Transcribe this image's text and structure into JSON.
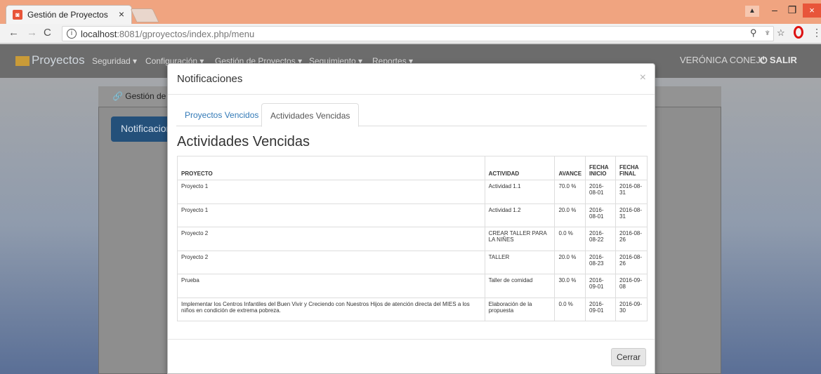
{
  "browser": {
    "tab_title": "Gestión de Proyectos",
    "tab_close": "×",
    "url_host": "localhost",
    "url_rest": ":8081/gproyectos/index.php/menu",
    "window_min": "–",
    "window_max": "❐",
    "window_close": "×"
  },
  "navbar": {
    "brand": "Proyectos",
    "items": [
      "Seguridad",
      "Configuración",
      "Gestión de Proyectos",
      "Seguimiento",
      "Reportes"
    ],
    "user": "VERÓNICA CONEJO",
    "logout": "SALIR"
  },
  "background": {
    "panel_title": "Gestión de Pr",
    "notif_button": "Notificacion"
  },
  "modal": {
    "title": "Notificaciones",
    "close": "×",
    "tabs": [
      "Proyectos Vencidos",
      "Actividades Vencidas"
    ],
    "section_title": "Actividades Vencidas",
    "columns": [
      "PROYECTO",
      "ACTIVIDAD",
      "AVANCE",
      "FECHA INICIO",
      "FECHA FINAL"
    ],
    "rows": [
      {
        "proyecto": "Proyecto 1",
        "actividad": "Actividad 1.1",
        "avance": "70.0 %",
        "inicio": "2016-08-01",
        "final": "2016-08-31"
      },
      {
        "proyecto": "Proyecto 1",
        "actividad": "Actividad 1.2",
        "avance": "20.0 %",
        "inicio": "2016-08-01",
        "final": "2016-08-31"
      },
      {
        "proyecto": "Proyecto 2",
        "actividad": "CREAR TALLER PARA LA NIÑES",
        "avance": "0.0 %",
        "inicio": "2016-08-22",
        "final": "2016-08-26"
      },
      {
        "proyecto": "Proyecto 2",
        "actividad": "TALLER",
        "avance": "20.0 %",
        "inicio": "2016-08-23",
        "final": "2016-08-26"
      },
      {
        "proyecto": "Prueba",
        "actividad": "Taller de comidad",
        "avance": "30.0 %",
        "inicio": "2016-09-01",
        "final": "2016-09-08"
      },
      {
        "proyecto": "Implementar los Centros Infantiles del Buen Vivir y Creciendo con Nuestros Hijos de atención directa del MIES a los niños en condición de extrema pobreza.",
        "actividad": "Elaboración de la propuesta",
        "avance": "0.0 %",
        "inicio": "2016-09-01",
        "final": "2016-09-30"
      }
    ],
    "footer_button": "Cerrar"
  },
  "colors": {
    "tabstrip": "#f0a480",
    "link": "#337ab7",
    "close_red": "#e8553a"
  }
}
